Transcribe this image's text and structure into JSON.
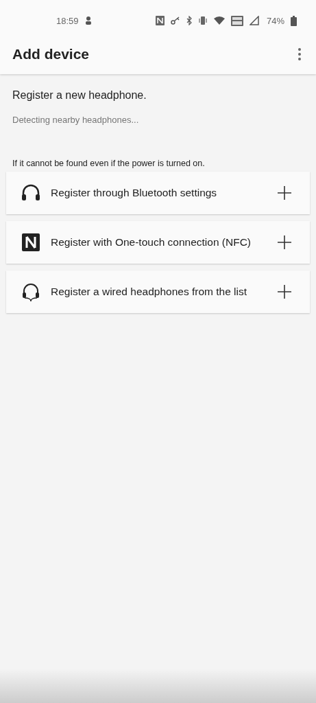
{
  "status_bar": {
    "time": "18:59",
    "battery": "74%"
  },
  "app_bar": {
    "title": "Add device"
  },
  "intro": "Register a new headphone.",
  "status_text": "Detecting nearby headphones...",
  "hint": "If it cannot be found even if the power is turned on.",
  "options": [
    {
      "kind": "headphones",
      "label": "Register through Bluetooth settings"
    },
    {
      "kind": "nfc",
      "label": "Register with One-touch connection (NFC)"
    },
    {
      "kind": "wired",
      "label": "Register a wired headphones from the list"
    }
  ]
}
